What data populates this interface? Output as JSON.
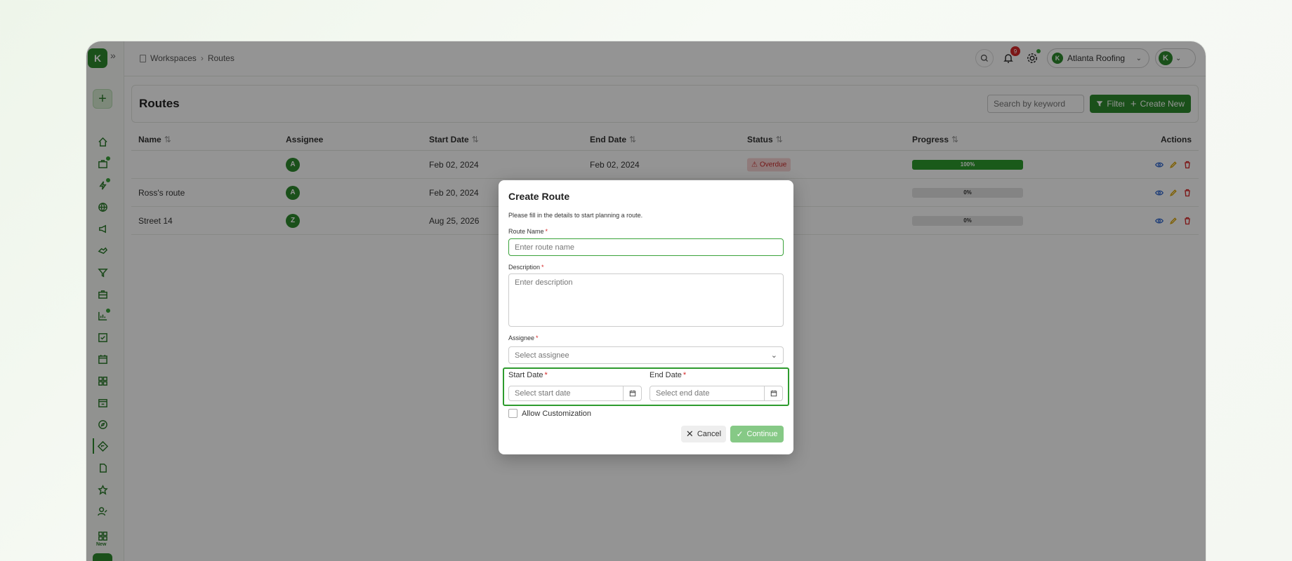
{
  "breadcrumb": {
    "items": [
      "Workspaces",
      "Routes"
    ]
  },
  "topbar": {
    "notification_count": "9",
    "org_name": "Atlanta Roofing",
    "org_initial": "K",
    "user_initial": "K"
  },
  "logo": {
    "initial": "K"
  },
  "sidebar": {
    "new_label": "New"
  },
  "page": {
    "title": "Routes",
    "search_placeholder": "Search by keyword",
    "filters_label": "Filters",
    "create_label": "Create New"
  },
  "table": {
    "columns": {
      "name": "Name",
      "assignee": "Assignee",
      "start": "Start Date",
      "end": "End Date",
      "status": "Status",
      "progress": "Progress",
      "actions": "Actions"
    },
    "rows": [
      {
        "name": "",
        "assignee": "A",
        "start": "Feb 02, 2024",
        "end": "Feb 02, 2024",
        "status": "Overdue",
        "progress": "100%",
        "progress_value": 100
      },
      {
        "name": "Ross's route",
        "assignee": "A",
        "start": "Feb 20, 2024",
        "end": "",
        "status": "",
        "progress": "0%",
        "progress_value": 0
      },
      {
        "name": "Street 14",
        "assignee": "Z",
        "start": "Aug 25, 2026",
        "end": "",
        "status": "",
        "progress": "0%",
        "progress_value": 0
      }
    ]
  },
  "modal": {
    "title": "Create Route",
    "subtitle": "Please fill in the details to start planning a route.",
    "route_name_label": "Route Name",
    "route_name_placeholder": "Enter route name",
    "description_label": "Description",
    "description_placeholder": "Enter description",
    "assignee_label": "Assignee",
    "assignee_placeholder": "Select assignee",
    "start_date_label": "Start Date",
    "start_date_placeholder": "Select start date",
    "end_date_label": "End Date",
    "end_date_placeholder": "Select end date",
    "allow_customization_label": "Allow Customization",
    "cancel_label": "Cancel",
    "continue_label": "Continue",
    "required_mark": "*"
  },
  "colors": {
    "brand": "#2e8b2e",
    "danger": "#d62828",
    "overlay": "rgba(0,0,0,0.42)"
  }
}
